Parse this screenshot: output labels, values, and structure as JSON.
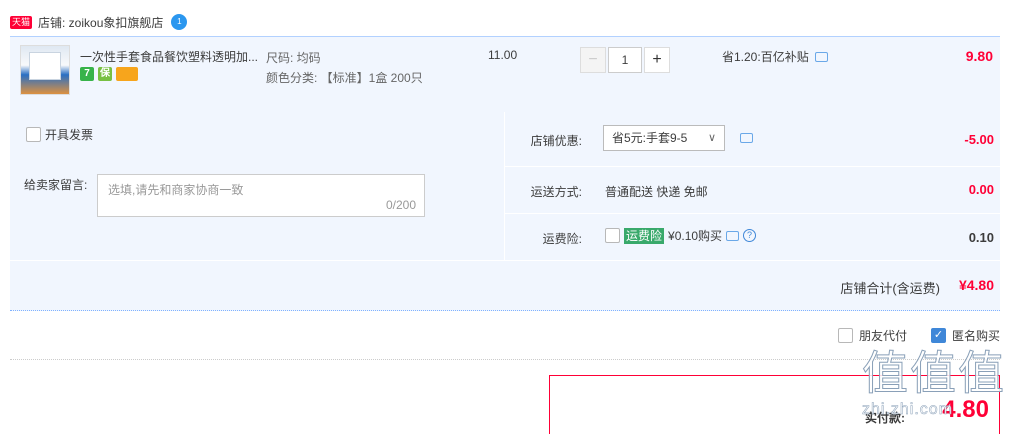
{
  "shop": {
    "badge": "天猫",
    "name_label": "店铺: zoikou象扣旗舰店",
    "chat_badge": "1"
  },
  "item": {
    "title": "一次性手套食品餐饮塑料透明加...",
    "sku_size": "尺码: 均码",
    "sku_color": "颜色分类: 【标准】1盒 200只",
    "unit_price": "11.00",
    "quantity": "1",
    "minus": "−",
    "plus": "+",
    "saving": "省1.20:百亿补贴",
    "subtotal": "9.80",
    "badges": [
      "7",
      "保",
      ""
    ]
  },
  "options": {
    "invoice_label": "开具发票",
    "message_label": "给卖家留言:",
    "message_placeholder": "选填,请先和商家协商一致",
    "message_count": "0/200",
    "discount_label": "店铺优惠:",
    "discount_value": "省5元:手套9-5",
    "discount_amount": "-5.00",
    "shipping_label": "运送方式:",
    "shipping_value": "普通配送 快递 免邮",
    "shipping_amount": "0.00",
    "insurance_label": "运费险:",
    "insurance_tag": "运费险",
    "insurance_text": "¥0.10购买",
    "insurance_amount": "0.10"
  },
  "shop_total": {
    "label": "店铺合计(含运费)",
    "value": "¥4.80"
  },
  "bottom": {
    "friend_pay": "朋友代付",
    "anonymous": "匿名购买"
  },
  "payment": {
    "label": "实付款:",
    "value": "4.80"
  },
  "watermark": {
    "glyphs": "值值值",
    "site": "zhi.zhi.com"
  },
  "colors": {
    "accent_red": "#ff0036",
    "panel_blue": "#f1f6fe",
    "check_blue": "#3f87d8",
    "insurance_green": "#39a96b"
  }
}
